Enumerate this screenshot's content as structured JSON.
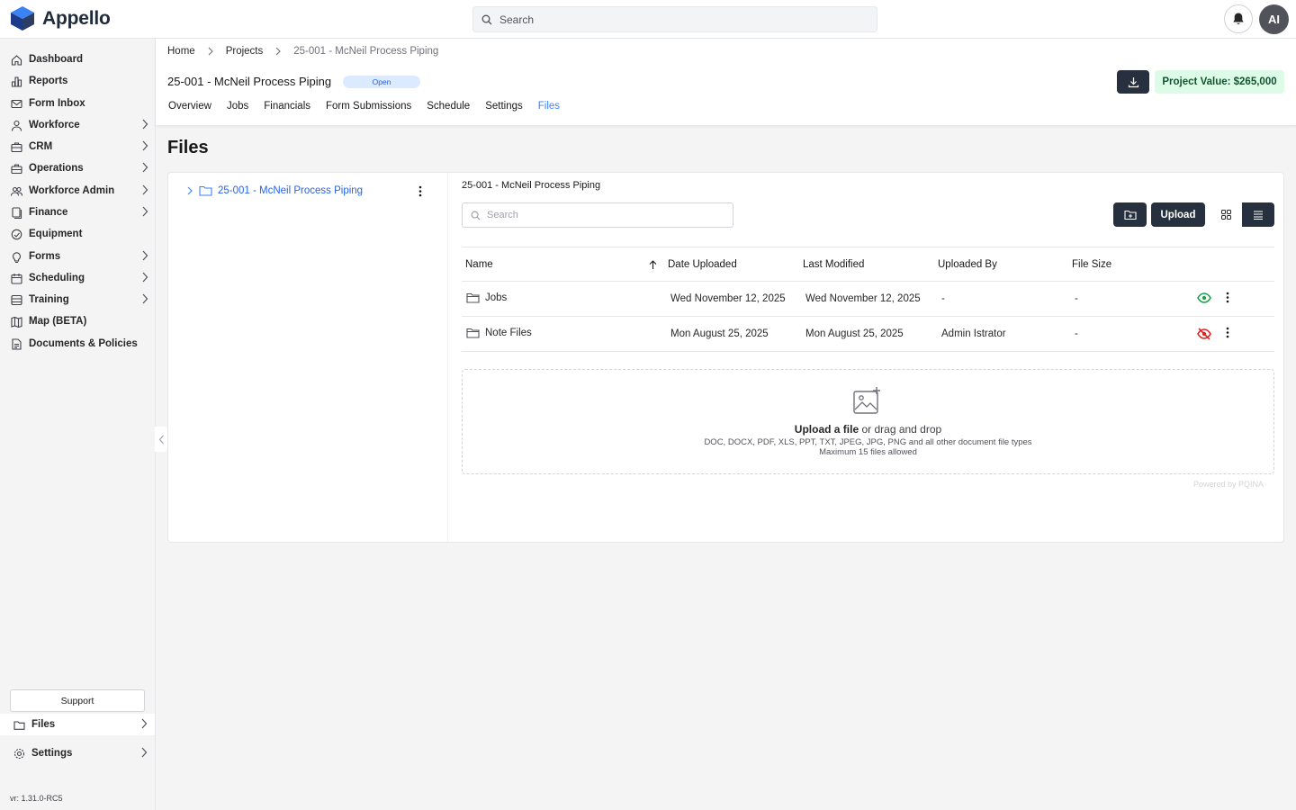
{
  "app": {
    "name": "Appello"
  },
  "topbar": {
    "search_placeholder": "Search",
    "avatar_initials": "AI"
  },
  "sidebar": {
    "items": [
      {
        "label": "Dashboard",
        "icon": "home-icon",
        "chevron": false
      },
      {
        "label": "Reports",
        "icon": "bar-chart-icon",
        "chevron": false
      },
      {
        "label": "Form Inbox",
        "icon": "mail-icon",
        "chevron": false
      },
      {
        "label": "Workforce",
        "icon": "user-icon",
        "chevron": true
      },
      {
        "label": "CRM",
        "icon": "briefcase-icon",
        "chevron": true
      },
      {
        "label": "Operations",
        "icon": "toolbox-icon",
        "chevron": true
      },
      {
        "label": "Workforce Admin",
        "icon": "users-icon",
        "chevron": true
      },
      {
        "label": "Finance",
        "icon": "document-stack-icon",
        "chevron": true
      },
      {
        "label": "Equipment",
        "icon": "gauge-icon",
        "chevron": false
      },
      {
        "label": "Forms",
        "icon": "lightbulb-icon",
        "chevron": true
      },
      {
        "label": "Scheduling",
        "icon": "calendar-icon",
        "chevron": true
      },
      {
        "label": "Training",
        "icon": "layers-icon",
        "chevron": true
      },
      {
        "label": "Map (BETA)",
        "icon": "map-icon",
        "chevron": false
      },
      {
        "label": "Documents & Policies",
        "icon": "file-text-icon",
        "chevron": false
      }
    ],
    "support_label": "Support",
    "files_label": "Files",
    "settings_label": "Settings",
    "version": "vr: 1.31.0-RC5"
  },
  "header": {
    "breadcrumbs": [
      "Home",
      "Projects",
      "25-001 - McNeil Process Piping"
    ],
    "project_title": "25-001 - McNeil Process Piping",
    "status_badge": "Open",
    "tabs": [
      "Overview",
      "Jobs",
      "Financials",
      "Form Submissions",
      "Schedule",
      "Settings",
      "Files"
    ],
    "active_tab": "Files",
    "project_value": "Project Value: $265,000"
  },
  "page": {
    "heading": "Files"
  },
  "tree": {
    "root_label": "25-001 - McNeil Process Piping"
  },
  "files": {
    "folder_title": "25-001 - McNeil Process Piping",
    "search_placeholder": "Search",
    "upload_label": "Upload",
    "columns": [
      "Name",
      "Date Uploaded",
      "Last Modified",
      "Uploaded By",
      "File Size"
    ],
    "rows": [
      {
        "name": "Jobs",
        "date_uploaded": "Wed November 12, 2025",
        "last_modified": "Wed November 12, 2025",
        "uploaded_by": "-",
        "file_size": "-",
        "visible": true
      },
      {
        "name": "Note Files",
        "date_uploaded": "Mon August 25, 2025",
        "last_modified": "Mon August 25, 2025",
        "uploaded_by": "Admin Istrator",
        "file_size": "-",
        "visible": false
      }
    ],
    "dropzone": {
      "link": "Upload a file",
      "rest": " or drag and drop",
      "types": "DOC, DOCX, PDF, XLS, PPT, TXT, JPEG, JPG, PNG and all other document file types",
      "limit": "Maximum 15 files allowed"
    },
    "powered_by": "Powered by PQINA"
  },
  "colors": {
    "primary_dark": "#27303f",
    "accent_blue": "#3b82f6",
    "visible_green": "#16a34a",
    "hidden_red": "#dc2626",
    "value_bg": "#dcfce7"
  }
}
